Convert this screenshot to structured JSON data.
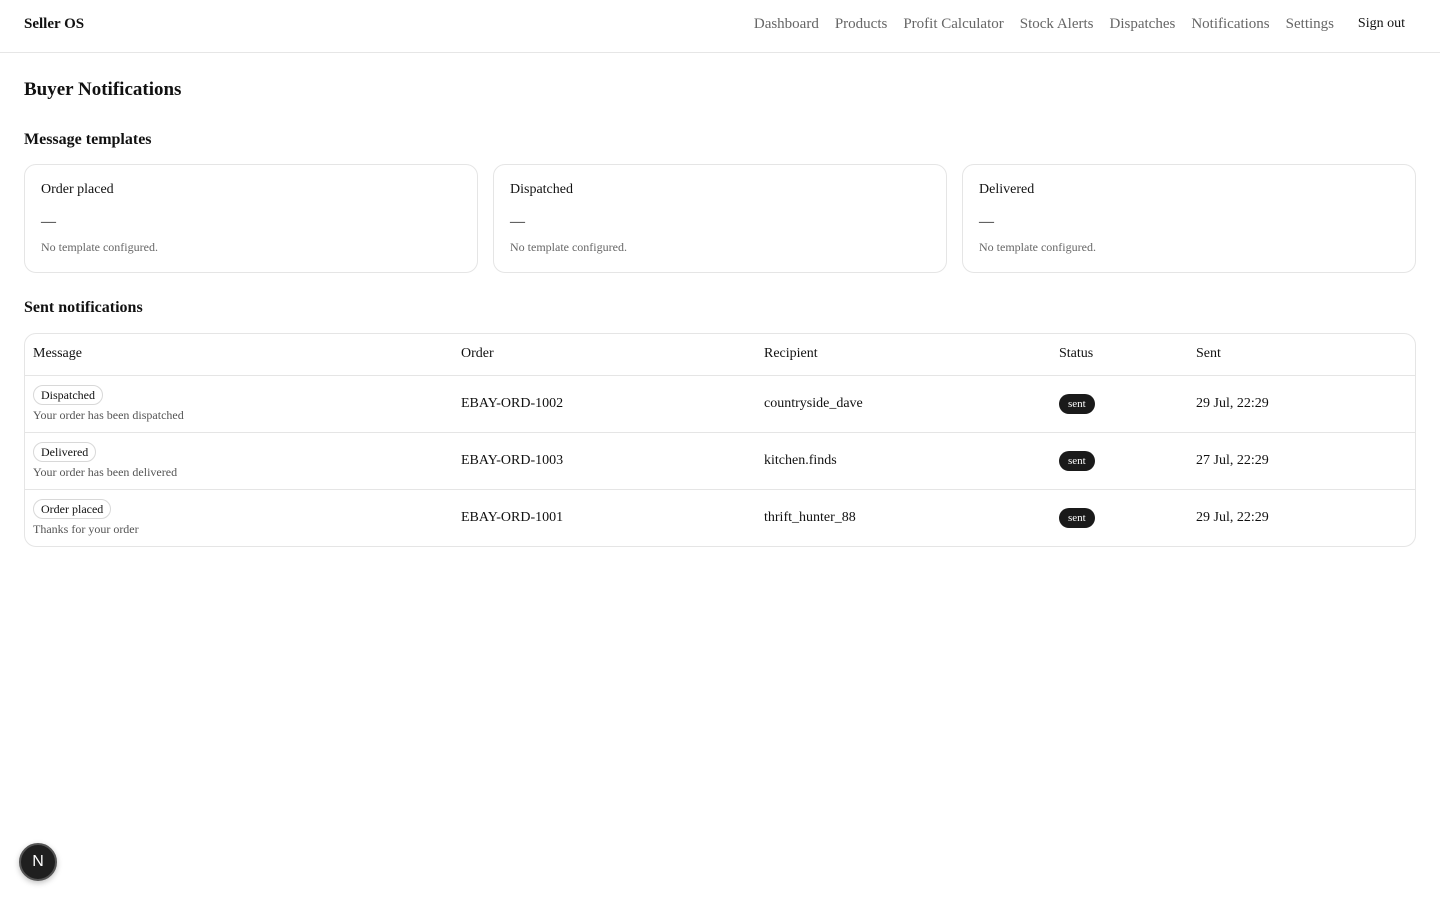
{
  "header": {
    "brand": "Seller OS",
    "nav": [
      "Dashboard",
      "Products",
      "Profit Calculator",
      "Stock Alerts",
      "Dispatches",
      "Notifications",
      "Settings"
    ],
    "sign_out": "Sign out"
  },
  "page_title": "Buyer Notifications",
  "templates": {
    "title": "Message templates",
    "cards": [
      {
        "title": "Order placed",
        "value": "—",
        "note": "No template configured."
      },
      {
        "title": "Dispatched",
        "value": "—",
        "note": "No template configured."
      },
      {
        "title": "Delivered",
        "value": "—",
        "note": "No template configured."
      }
    ]
  },
  "sent": {
    "title": "Sent notifications",
    "columns": [
      "Message",
      "Order",
      "Recipient",
      "Status",
      "Sent"
    ],
    "rows": [
      {
        "type": "Dispatched",
        "message": "Your order has been dispatched",
        "order": "EBAY-ORD-1002",
        "recipient": "countryside_dave",
        "status": "sent",
        "sent": "29 Jul, 22:29"
      },
      {
        "type": "Delivered",
        "message": "Your order has been delivered",
        "order": "EBAY-ORD-1003",
        "recipient": "kitchen.finds",
        "status": "sent",
        "sent": "27 Jul, 22:29"
      },
      {
        "type": "Order placed",
        "message": "Thanks for your order",
        "order": "EBAY-ORD-1001",
        "recipient": "thrift_hunter_88",
        "status": "sent",
        "sent": "29 Jul, 22:29"
      }
    ]
  },
  "dev_indicator": {
    "label": "N",
    "icon": "nextjs-logo-icon"
  }
}
